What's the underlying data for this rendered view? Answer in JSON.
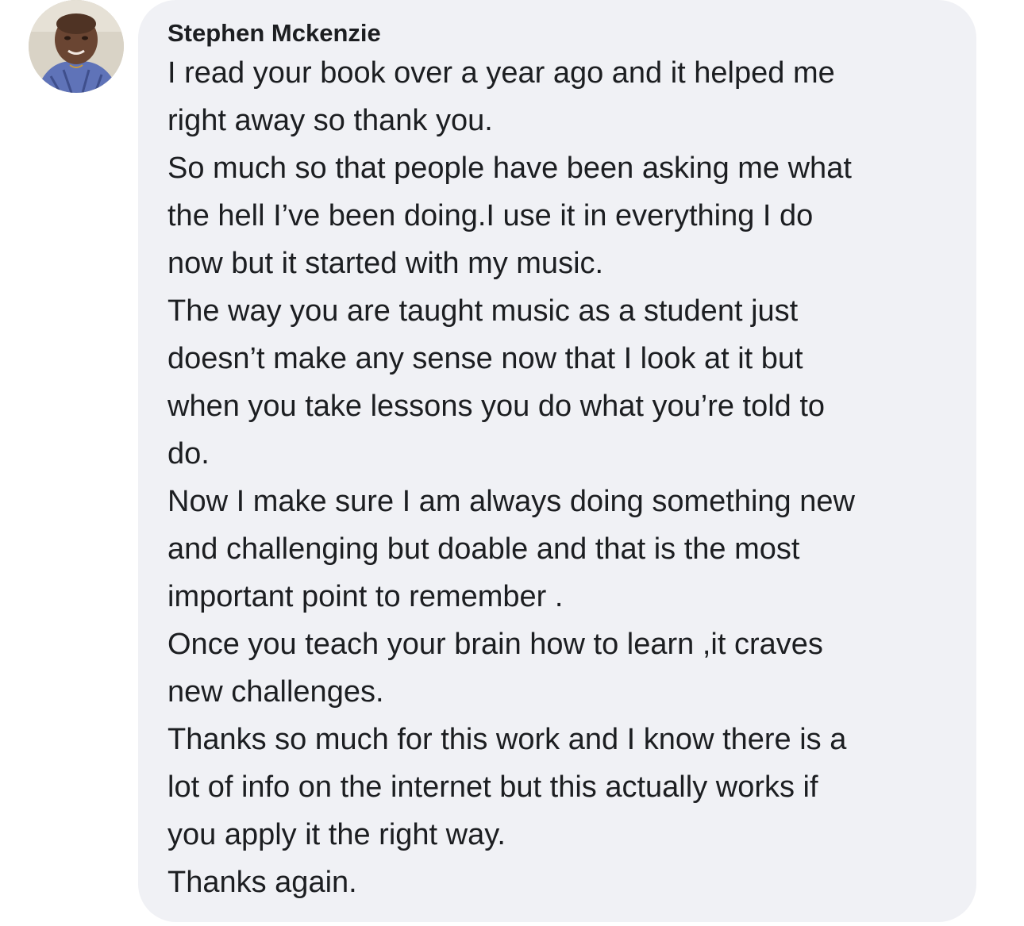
{
  "comment": {
    "author_name": "Stephen Mckenzie",
    "avatar_icon": "profile-photo",
    "lines": [
      "I read your book over a year ago and it helped me",
      "right away so thank you.",
      "So much so that people have been asking me what",
      "the hell I’ve been doing.I use it in everything I do",
      "now but it started with my music.",
      "The way you are taught music as a student just",
      "doesn’t make any sense now that I look at it but",
      "when you take lessons you do what you’re told to",
      "do.",
      "Now I make sure I am always doing something new",
      "and challenging but doable and that is the most",
      "important point to remember .",
      "Once you teach your brain how to learn ,it craves",
      "new challenges.",
      "Thanks so much for this work and I know there is a",
      "lot of info on the internet but this actually works if",
      "you apply it the right way.",
      "Thanks again."
    ]
  },
  "colors": {
    "bubble_background": "#f0f1f5",
    "text": "#1c1e21",
    "page_background": "#ffffff"
  }
}
